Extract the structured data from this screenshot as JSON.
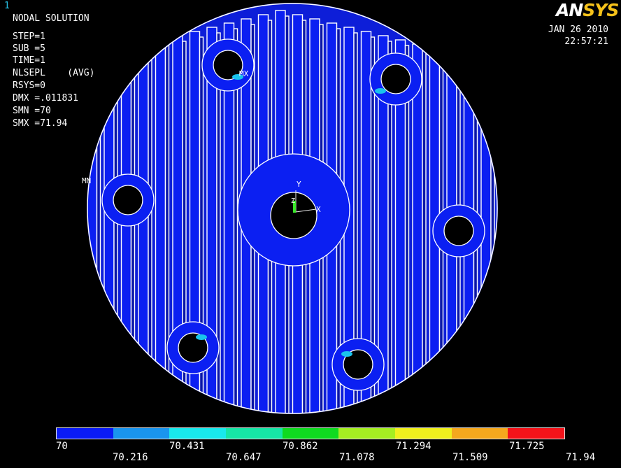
{
  "window_number": "1",
  "title": "NODAL SOLUTION",
  "stats": [
    "STEP=1",
    "SUB =5",
    "TIME=1",
    "NLSEPL    (AVG)",
    "RSYS=0",
    "DMX =.011831",
    "SMN =70",
    "SMX =71.94"
  ],
  "logo": {
    "prefix": "AN",
    "suffix": "SYS"
  },
  "date": "JAN 26 2010",
  "time": "22:57:21",
  "markers": {
    "mx": "MX",
    "mn": "MN"
  },
  "axes": {
    "y": "Y",
    "z": "Z",
    "x": "X"
  },
  "legend": {
    "colors": [
      "#0a1bf6",
      "#1a95ee",
      "#19e9ec",
      "#16e6a6",
      "#0fda20",
      "#a5ee22",
      "#f0f01e",
      "#f5a81e",
      "#f4131a"
    ],
    "upper_ticks": [
      "70",
      "70.431",
      "70.862",
      "71.294",
      "71.725"
    ],
    "lower_ticks": [
      "70.216",
      "70.647",
      "71.078",
      "71.509",
      "71.94"
    ]
  }
}
